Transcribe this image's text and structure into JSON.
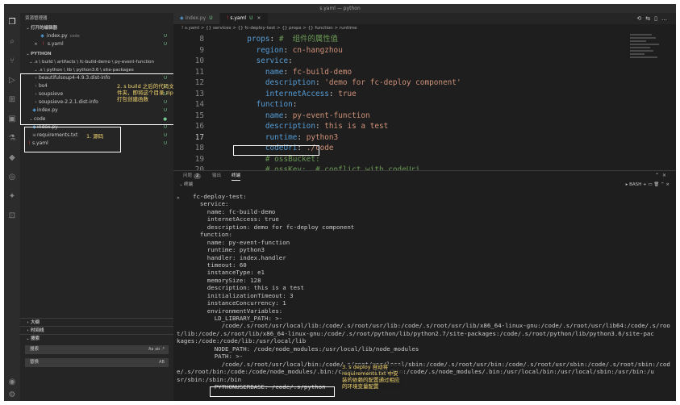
{
  "window": {
    "title": "s.yaml — python"
  },
  "sidebar": {
    "title": "资源管理器",
    "open_editors": {
      "title": "打开的编辑器",
      "items": [
        {
          "name": "index.py",
          "folder": "code",
          "badge": "U"
        },
        {
          "name": "s.yaml",
          "badge": "U"
        }
      ]
    },
    "project": {
      "title": "PYTHON",
      "path": ".s \\ build \\ artifacts \\ fc-build-demo \\ py-event-function",
      "subpath": ".s \\ python \\ lib \\ python3.6 \\ site-packages",
      "items": [
        {
          "name": "beautifulsoup4-4.9.3.dist-info",
          "badge": "U"
        },
        {
          "name": "bs4",
          "badge": "U"
        },
        {
          "name": "soupsieve",
          "badge": "U"
        },
        {
          "name": "soupsieve-2.2.1.dist-info",
          "badge": "U"
        },
        {
          "name": "index.py",
          "badge": "U"
        },
        {
          "name": "code",
          "badge": ""
        },
        {
          "name": "index.py",
          "badge": "U"
        },
        {
          "name": "requirements.txt",
          "badge": "U"
        },
        {
          "name": "s.yaml",
          "badge": "U"
        }
      ]
    },
    "outline_title": "大纲",
    "timeline_title": "时间线",
    "search": {
      "title": "搜索",
      "find_placeholder": "搜索",
      "find_options": "Aa ab .*",
      "replace_placeholder": "替换",
      "replace_options": "AB"
    }
  },
  "tabs": [
    {
      "label": "index.py",
      "badge": "U",
      "active": false
    },
    {
      "label": "s.yaml",
      "badge": "U",
      "active": true
    }
  ],
  "breadcrumb": "! s.yaml > {} services > {} fc-deploy-test > {} props > {} function > runtime",
  "code_lines": [
    {
      "ln": "8",
      "indent": "  ",
      "key": "props",
      "rest": "",
      "comment": "#  组件的属性值"
    },
    {
      "ln": "9",
      "indent": "    ",
      "key": "region",
      "rest": "cn-hangzhou",
      "comment": ""
    },
    {
      "ln": "10",
      "indent": "    ",
      "key": "service",
      "rest": "",
      "comment": ""
    },
    {
      "ln": "11",
      "indent": "      ",
      "key": "name",
      "rest": "fc-build-demo",
      "comment": ""
    },
    {
      "ln": "12",
      "indent": "      ",
      "key": "description",
      "rest": "'demo for fc-deploy component'",
      "comment": ""
    },
    {
      "ln": "13",
      "indent": "      ",
      "key": "internetAccess",
      "rest": "true",
      "comment": ""
    },
    {
      "ln": "14",
      "indent": "    ",
      "key": "function",
      "rest": "",
      "comment": ""
    },
    {
      "ln": "15",
      "indent": "      ",
      "key": "name",
      "rest": "py-event-function",
      "comment": ""
    },
    {
      "ln": "16",
      "indent": "      ",
      "key": "description",
      "rest": "this is a test",
      "comment": ""
    },
    {
      "ln": "17",
      "indent": "      ",
      "key": "runtime",
      "rest": "python3",
      "comment": ""
    },
    {
      "ln": "18",
      "indent": "      ",
      "key": "codeUri",
      "rest": "./code",
      "comment": ""
    },
    {
      "ln": "19",
      "indent": "      ",
      "key": "",
      "rest": "",
      "comment": "# ossBucket:"
    },
    {
      "ln": "20",
      "indent": "      ",
      "key": "",
      "rest": "",
      "comment": "# ossKey:  # conflict with codeUri"
    }
  ],
  "panel": {
    "tabs": [
      "问题",
      "输出",
      "终端"
    ],
    "problems_count": "2",
    "terminal_header": "终端",
    "shell": "BASH"
  },
  "terminal_lines": [
    "fc-deploy-test:",
    "  service:",
    "    name: fc-build-demo",
    "    internetAccess: true",
    "    description: demo for fc-deploy component",
    "  function:",
    "    name: py-event-function",
    "    runtime: python3",
    "    handler: index.handler",
    "    timeout: 60",
    "    instanceType: e1",
    "    memorySize: 128",
    "    description: this is a test",
    "    initializationTimeout: 3",
    "    instanceConcurrency: 1",
    "    environmentVariables:",
    "      LD_LIBRARY_PATH: >-",
    "        /code/.s/root/usr/local/lib:/code/.s/root/usr/lib:/code/.s/root/usr/lib/x86_64-linux-gnu:/code/.s/root/usr/lib64:/code/.s/roo",
    "t/lib:/code/.s/root/lib/x86_64-linux-gnu:/code/.s/root/python/lib/python2.7/site-packages:/code/.s/root/python/lib/python3.6/site-pac",
    "kages:/code:/code/lib:/usr/local/lib",
    "      NODE_PATH: /code/node_modules:/usr/local/lib/node_modules",
    "      PATH: >-",
    "        /code/.s/root/usr/local/bin:/code/.s/root/usr/local/sbin:/code/.s/root/usr/bin:/code/.s/root/usr/sbin:/code/.s/root/sbin:/cod",
    "e/.s/root/bin:/code:/code/node_modules/.bin:/code/.s/python/bin:/code/.s/node_modules/.bin:/usr/local/bin:/usr/local/sbin:/usr/bin:/u",
    "sr/sbin:/sbin:/bin",
    "      PYTHONUSERBASE: /code/.s/python"
  ],
  "annotations": {
    "note1": "1. 源码",
    "note2": "2. s build 之后的代码文件夹，即将这个目录 zip 打包创建函数",
    "note3": "3. s deploy 自动将 requirements.txt 中安装的依赖的配置通过相应的环境变量配置"
  }
}
